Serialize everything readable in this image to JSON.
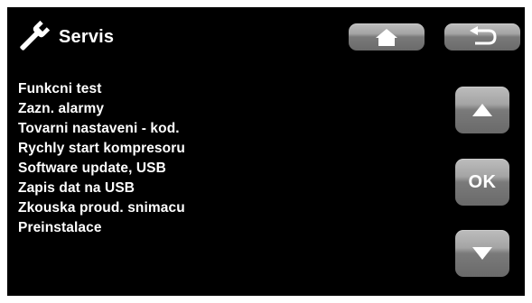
{
  "header": {
    "title": "Servis",
    "icon": "wrench-icon"
  },
  "menu": {
    "items": [
      {
        "label": "Funkcni test"
      },
      {
        "label": "Zazn. alarmy"
      },
      {
        "label": "Tovarni nastaveni - kod."
      },
      {
        "label": "Rychly start kompresoru"
      },
      {
        "label": "Software update, USB"
      },
      {
        "label": "Zapis dat na USB"
      },
      {
        "label": "Zkouska proud. snimacu"
      },
      {
        "label": "Preinstalace"
      }
    ]
  },
  "buttons": {
    "home_icon": "home-icon",
    "back_icon": "back-icon",
    "up_icon": "arrow-up-icon",
    "ok_label": "OK",
    "down_icon": "arrow-down-icon"
  },
  "colors": {
    "background": "#000000",
    "text": "#ffffff",
    "button_gray": "#8f8f8f"
  }
}
